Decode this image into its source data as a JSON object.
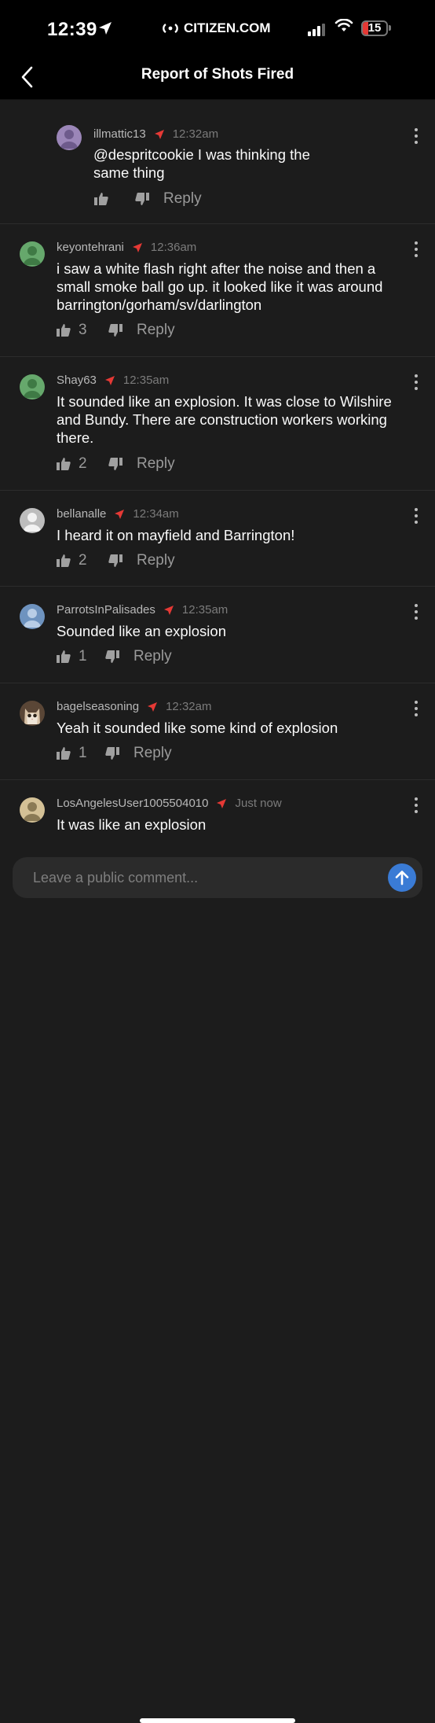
{
  "status_bar": {
    "time": "12:39",
    "site": "CITIZEN.COM",
    "battery": "15"
  },
  "nav": {
    "title": "Report of Shots Fired"
  },
  "colors": {
    "accent_red": "#e53935",
    "send_blue": "#3a7bd5"
  },
  "comments": [
    {
      "username": "illmattic13",
      "time": "12:32am",
      "text": "@despritcookie I was thinking the same thing",
      "likes": "",
      "reply_label": "Reply",
      "avatar": "purple-person-avatar"
    },
    {
      "username": "keyontehrani",
      "time": "12:36am",
      "text": "i saw a white flash right after the noise and then a small smoke ball go up. it looked like it was around barrington/gorham/sv/darlington",
      "likes": "3",
      "reply_label": "Reply",
      "avatar": "green-person-avatar"
    },
    {
      "username": "Shay63",
      "time": "12:35am",
      "text": "It sounded like an explosion. It was close to Wilshire and Bundy. There are construction workers working there.",
      "likes": "2",
      "reply_label": "Reply",
      "avatar": "green-person-avatar"
    },
    {
      "username": "bellanalle",
      "time": "12:34am",
      "text": "I heard it on mayfield and Barrington!",
      "likes": "2",
      "reply_label": "Reply",
      "avatar": "gray-person-avatar"
    },
    {
      "username": "ParrotsInPalisades",
      "time": "12:35am",
      "text": "Sounded like an explosion",
      "likes": "1",
      "reply_label": "Reply",
      "avatar": "blue-person-avatar"
    },
    {
      "username": "bagelseasoning",
      "time": "12:32am",
      "text": "Yeah it sounded like some kind of explosion",
      "likes": "1",
      "reply_label": "Reply",
      "avatar": "cat-photo-avatar"
    },
    {
      "username": "LosAngelesUser1005504010",
      "time": "Just now",
      "text": "It was like an explosion",
      "likes": "",
      "reply_label": "",
      "avatar": "tan-person-avatar"
    }
  ],
  "input": {
    "placeholder": "Leave a public comment..."
  }
}
